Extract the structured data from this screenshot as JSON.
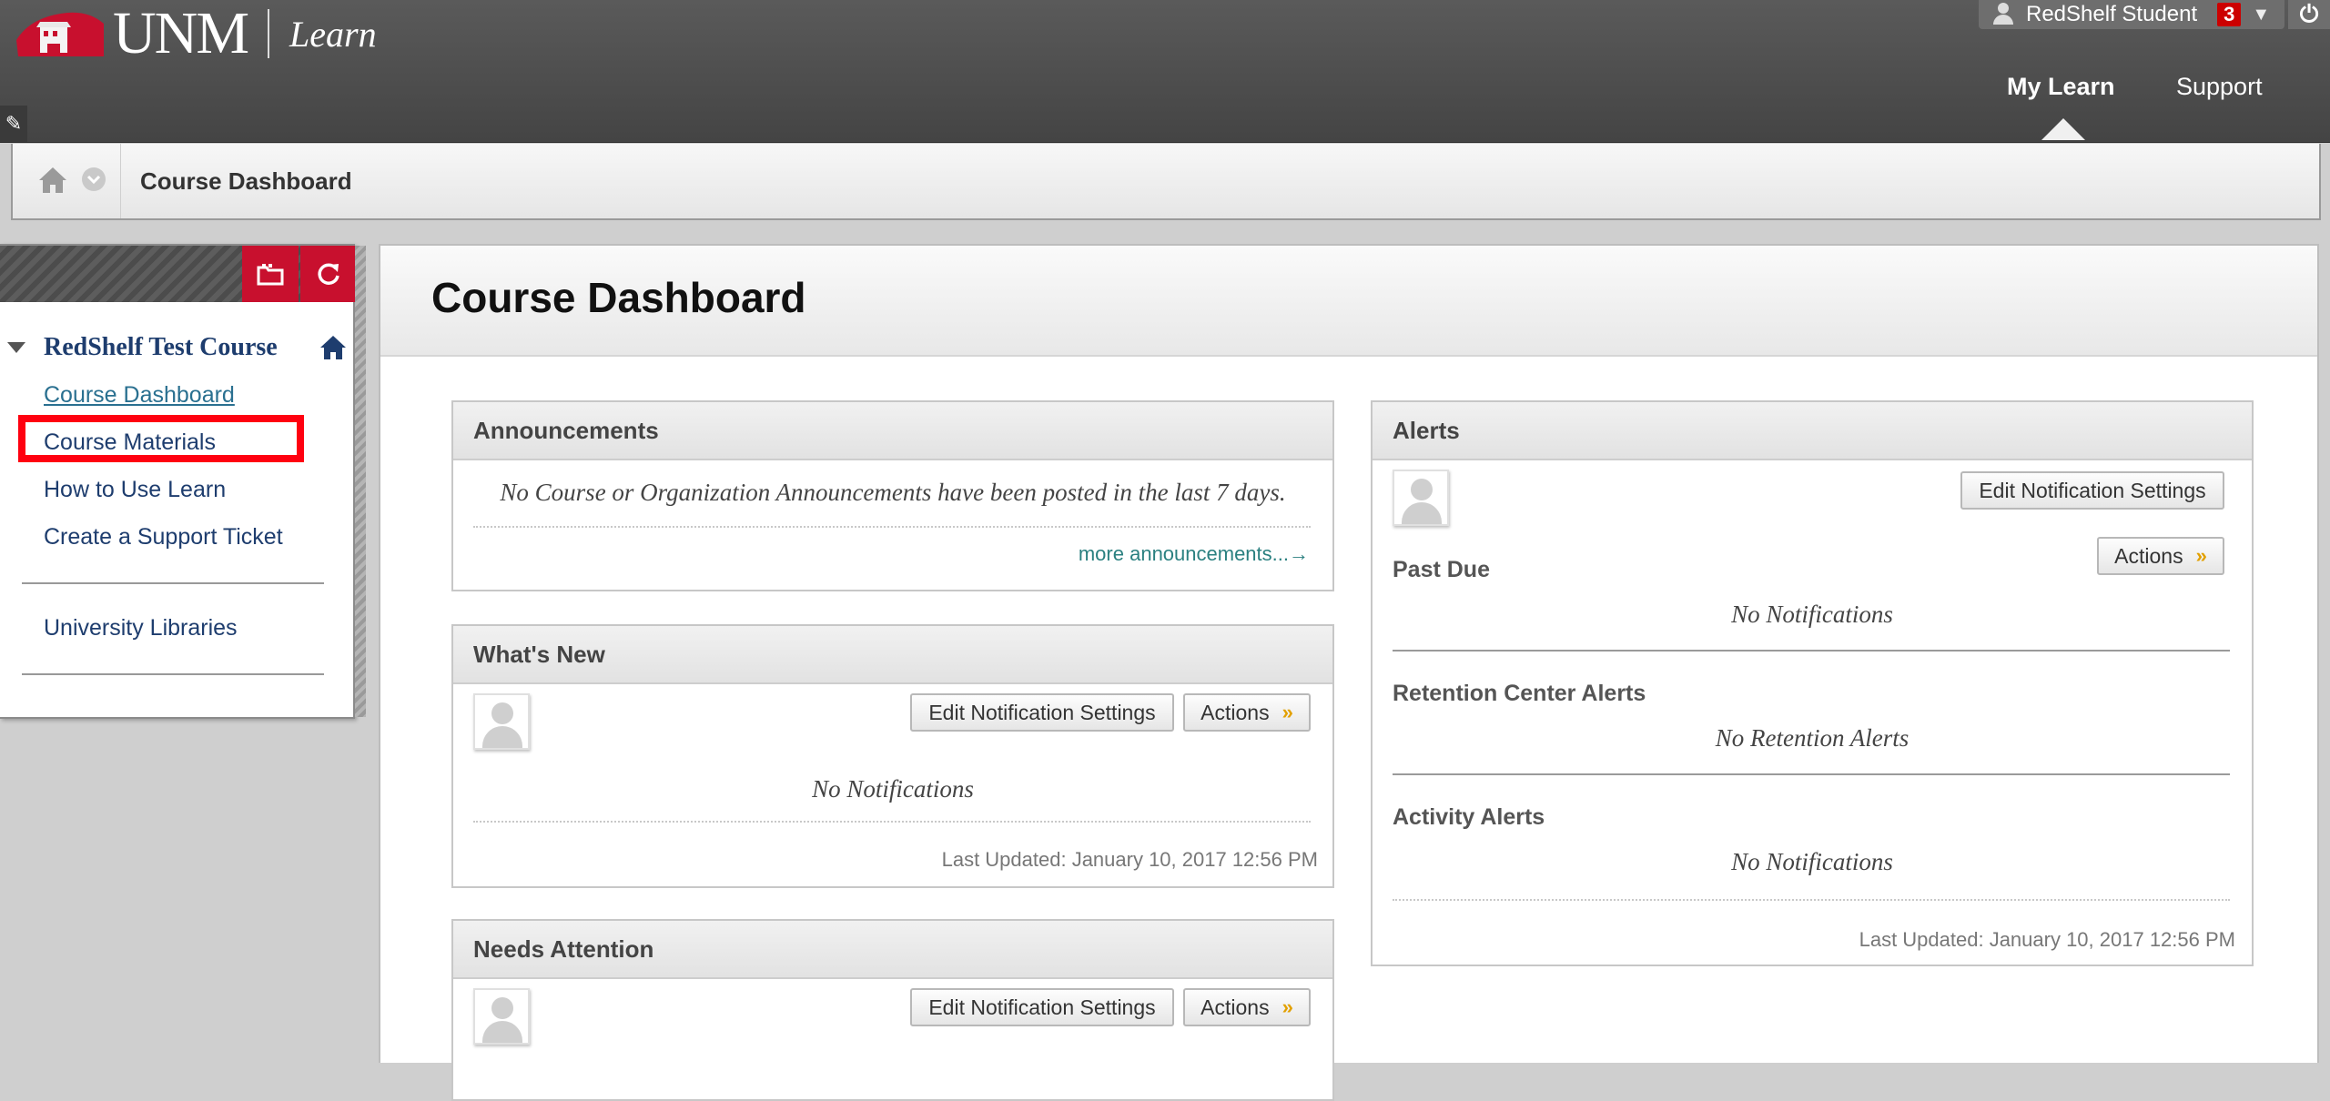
{
  "header": {
    "logo_unm": "UNM",
    "logo_learn": "Learn",
    "user_name": "RedShelf Student",
    "notification_count": "3",
    "nav_tabs": [
      {
        "label": "My Learn",
        "active": true
      },
      {
        "label": "Support",
        "active": false
      }
    ],
    "brand_color": "#c8102e"
  },
  "breadcrumb": {
    "current": "Course Dashboard"
  },
  "course_menu": {
    "course_title": "RedShelf Test Course",
    "items": [
      {
        "label": "Course Dashboard",
        "current": true
      },
      {
        "label": "Course Materials",
        "current": false,
        "highlighted": true
      },
      {
        "label": "How to Use Learn",
        "current": false
      },
      {
        "label": "Create a Support Ticket",
        "current": false
      },
      {
        "label": "University Libraries",
        "current": false
      }
    ]
  },
  "page": {
    "title": "Course Dashboard"
  },
  "announcements": {
    "title": "Announcements",
    "message": "No Course or Organization Announcements have been posted in the last 7 days.",
    "more_link": "more announcements...→"
  },
  "whats_new": {
    "title": "What's New",
    "edit_btn": "Edit Notification Settings",
    "actions_btn": "Actions",
    "message": "No Notifications",
    "last_updated": "Last Updated: January 10, 2017 12:56 PM"
  },
  "needs_attention": {
    "title": "Needs Attention",
    "edit_btn": "Edit Notification Settings",
    "actions_btn": "Actions"
  },
  "alerts": {
    "title": "Alerts",
    "edit_btn": "Edit Notification Settings",
    "actions_btn": "Actions",
    "past_due_title": "Past Due",
    "past_due_msg": "No Notifications",
    "retention_title": "Retention Center Alerts",
    "retention_msg": "No Retention Alerts",
    "activity_title": "Activity Alerts",
    "activity_msg": "No Notifications",
    "last_updated": "Last Updated: January 10, 2017 12:56 PM"
  }
}
